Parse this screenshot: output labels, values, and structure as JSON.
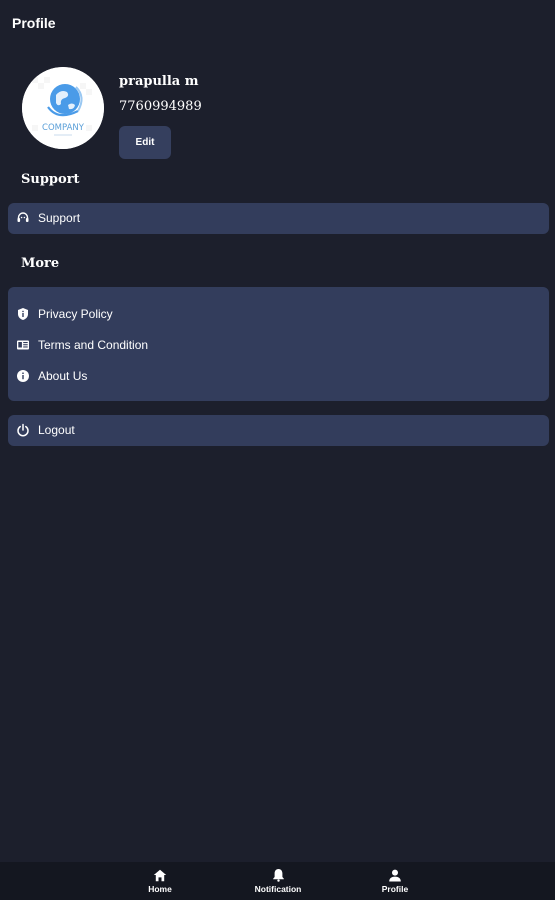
{
  "header": {
    "title": "Profile"
  },
  "profile": {
    "name": "prapulla m",
    "phone": "7760994989",
    "edit_label": "Edit",
    "avatar_logo_text": "COMPANY"
  },
  "support_section": {
    "heading": "Support",
    "items": [
      {
        "label": "Support",
        "icon": "headset-icon"
      }
    ]
  },
  "more_section": {
    "heading": "More",
    "items": [
      {
        "label": "Privacy Policy",
        "icon": "shield-icon"
      },
      {
        "label": "Terms and Condition",
        "icon": "document-icon"
      },
      {
        "label": "About Us",
        "icon": "info-icon"
      }
    ]
  },
  "logout": {
    "label": "Logout",
    "icon": "power-icon"
  },
  "bottom_nav": {
    "items": [
      {
        "label": "Home",
        "icon": "home-icon"
      },
      {
        "label": "Notification",
        "icon": "bell-icon"
      },
      {
        "label": "Profile",
        "icon": "person-icon"
      }
    ]
  },
  "colors": {
    "background": "#1c1f2c",
    "card": "#333d5c",
    "button": "#353f5e",
    "nav_background": "#141720",
    "logo_blue": "#4a9be8"
  }
}
